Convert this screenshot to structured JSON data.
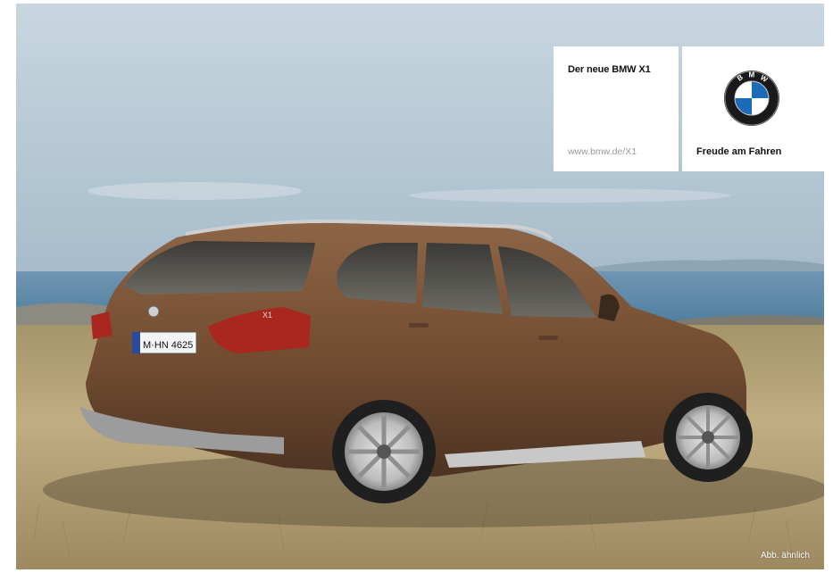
{
  "ad": {
    "headline": "Der neue BMW X1",
    "url": "www.bmw.de/X1",
    "slogan": "Freude am Fahren",
    "disclaimer": "Abb. ähnlich",
    "license_plate": "M·HN 4625",
    "model_badge": "X1",
    "logo_letters": [
      "B",
      "M",
      "W"
    ]
  },
  "colors": {
    "bmw_blue": "#1c6bb8",
    "car_bronze": "#7a5436",
    "panel_white": "#ffffff"
  }
}
